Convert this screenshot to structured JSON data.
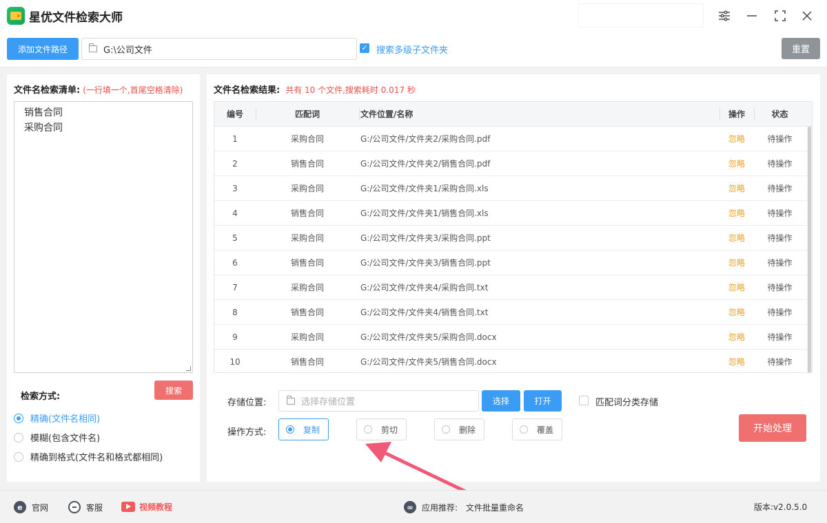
{
  "app": {
    "title": "星优文件检索大师"
  },
  "window_controls": [
    "settings-icon",
    "minimize-icon",
    "maximize-icon",
    "close-icon"
  ],
  "toolbar": {
    "add_path_label": "添加文件路径",
    "path_value": "G:\\公司文件",
    "subfolder_checkbox_label": "搜索多级子文件夹",
    "subfolder_checked": true,
    "reset_label": "重置"
  },
  "left": {
    "title": "文件名检索清单:",
    "hint": "(一行填一个,首尾空格清除)",
    "keywords": [
      "销售合同",
      "采购合同"
    ],
    "search_mode_title": "检索方式:",
    "search_button": "搜索",
    "modes": [
      {
        "label": "精确(文件名相同)",
        "selected": true
      },
      {
        "label": "模糊(包含文件名)",
        "selected": false
      },
      {
        "label": "精确到格式(文件名和格式都相同)",
        "selected": false
      }
    ]
  },
  "right": {
    "title": "文件名检索结果:",
    "count_text": "共有 10 个文件,搜索耗时 0.017 秒",
    "columns": [
      "编号",
      "匹配词",
      "文件位置/名称",
      "操作",
      "状态"
    ],
    "rows": [
      {
        "no": "1",
        "match": "采购合同",
        "path": "G:/公司文件/文件夹2/采购合同.pdf",
        "action": "忽略",
        "status": "待操作"
      },
      {
        "no": "2",
        "match": "销售合同",
        "path": "G:/公司文件/文件夹2/销售合同.pdf",
        "action": "忽略",
        "status": "待操作"
      },
      {
        "no": "3",
        "match": "采购合同",
        "path": "G:/公司文件/文件夹1/采购合同.xls",
        "action": "忽略",
        "status": "待操作"
      },
      {
        "no": "4",
        "match": "销售合同",
        "path": "G:/公司文件/文件夹1/销售合同.xls",
        "action": "忽略",
        "status": "待操作"
      },
      {
        "no": "5",
        "match": "采购合同",
        "path": "G:/公司文件/文件夹3/采购合同.ppt",
        "action": "忽略",
        "status": "待操作"
      },
      {
        "no": "6",
        "match": "销售合同",
        "path": "G:/公司文件/文件夹3/销售合同.ppt",
        "action": "忽略",
        "status": "待操作"
      },
      {
        "no": "7",
        "match": "采购合同",
        "path": "G:/公司文件/文件夹4/采购合同.txt",
        "action": "忽略",
        "status": "待操作"
      },
      {
        "no": "8",
        "match": "销售合同",
        "path": "G:/公司文件/文件夹4/销售合同.txt",
        "action": "忽略",
        "status": "待操作"
      },
      {
        "no": "9",
        "match": "采购合同",
        "path": "G:/公司文件/文件夹5/采购合同.docx",
        "action": "忽略",
        "status": "待操作"
      },
      {
        "no": "10",
        "match": "销售合同",
        "path": "G:/公司文件/文件夹5/销售合同.docx",
        "action": "忽略",
        "status": "待操作"
      }
    ],
    "store_label": "存储位置:",
    "store_placeholder": "选择存储位置",
    "choose_label": "选择",
    "open_label": "打开",
    "classify_label": "匹配词分类存储",
    "classify_checked": false,
    "op_label": "操作方式:",
    "ops": [
      {
        "label": "复制",
        "selected": true
      },
      {
        "label": "剪切",
        "selected": false
      },
      {
        "label": "删除",
        "selected": false
      },
      {
        "label": "覆盖",
        "selected": false
      }
    ],
    "start_label": "开始处理"
  },
  "statusbar": {
    "website": "官网",
    "support": "客服",
    "video": "视频教程",
    "recommend_prefix": "应用推荐:",
    "recommend_app": "文件批量重命名",
    "version": "版本:v2.0.5.0"
  },
  "colors": {
    "accent": "#3b9cf5",
    "danger": "#f07070",
    "warning": "#f0a020",
    "annotation_arrow": "#f05a78"
  }
}
